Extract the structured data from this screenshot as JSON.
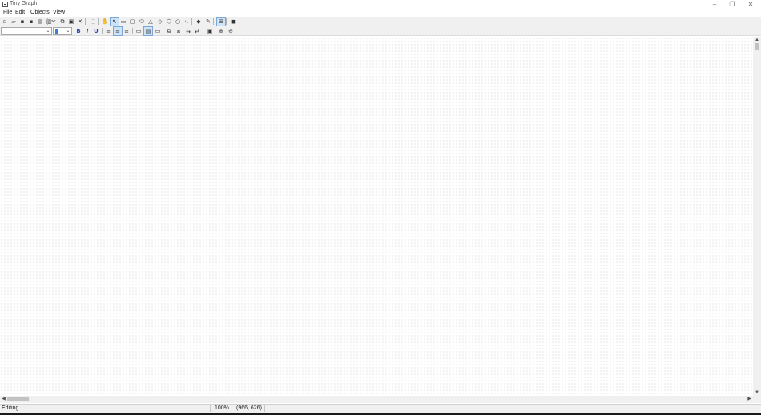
{
  "window": {
    "title": "Tiny Graph",
    "icon": "app-icon",
    "controls": {
      "minimize": "–",
      "maximize": "❐",
      "close": "✕"
    }
  },
  "menubar": [
    "File",
    "Edit",
    "Objects",
    "View"
  ],
  "toolbar1": [
    {
      "name": "new-icon",
      "glyph": "▫"
    },
    {
      "name": "open-icon",
      "glyph": "▱"
    },
    {
      "name": "save-icon",
      "glyph": "▪"
    },
    {
      "name": "save-as-icon",
      "glyph": "▪"
    },
    {
      "name": "print-preview-icon",
      "glyph": "▤"
    },
    {
      "name": "print-icon",
      "glyph": "▥"
    },
    {
      "name": "cut-icon",
      "glyph": "✂"
    },
    {
      "name": "copy-icon",
      "glyph": "⧉"
    },
    {
      "name": "paste-icon",
      "glyph": "▣"
    },
    {
      "name": "delete-icon",
      "glyph": "✕"
    },
    {
      "name": "select-all-icon",
      "glyph": "⬚"
    },
    {
      "name": "pan-hand-icon",
      "glyph": "✋"
    },
    {
      "name": "pointer-tool-icon",
      "glyph": "↖",
      "active": true
    },
    {
      "name": "rectangle-tool-icon",
      "glyph": "▭"
    },
    {
      "name": "rounded-rectangle-tool-icon",
      "glyph": "▢"
    },
    {
      "name": "ellipse-tool-icon",
      "glyph": "⬭"
    },
    {
      "name": "triangle-tool-icon",
      "glyph": "△"
    },
    {
      "name": "diamond-tool-icon",
      "glyph": "◇"
    },
    {
      "name": "hexagon-tool-icon",
      "glyph": "⬡"
    },
    {
      "name": "octagon-tool-icon",
      "glyph": "○"
    },
    {
      "name": "connector-tool-icon",
      "glyph": "⤷"
    },
    {
      "name": "fill-color-icon",
      "glyph": "◆"
    },
    {
      "name": "line-color-icon",
      "glyph": "✎"
    },
    {
      "name": "grid-toggle-icon",
      "glyph": "⊞",
      "active": true
    },
    {
      "name": "properties-icon",
      "glyph": "◼"
    }
  ],
  "font_combo": {
    "value": ""
  },
  "size_combo": {
    "value": ""
  },
  "toolbar2": [
    {
      "name": "bold-icon",
      "glyph": "B"
    },
    {
      "name": "italic-icon",
      "glyph": "I"
    },
    {
      "name": "underline-icon",
      "glyph": "U"
    },
    {
      "name": "align-left-icon",
      "glyph": "≡"
    },
    {
      "name": "align-center-icon",
      "glyph": "≡",
      "active": true
    },
    {
      "name": "align-right-icon",
      "glyph": "≡"
    },
    {
      "name": "layout-top-icon",
      "glyph": "▭"
    },
    {
      "name": "layout-middle-icon",
      "glyph": "▤",
      "active": true
    },
    {
      "name": "layout-bottom-icon",
      "glyph": "▭"
    },
    {
      "name": "group-icon",
      "glyph": "⧉"
    },
    {
      "name": "ungroup-icon",
      "glyph": "⧈"
    },
    {
      "name": "bring-to-front-icon",
      "glyph": "⇆"
    },
    {
      "name": "send-to-back-icon",
      "glyph": "⇄"
    },
    {
      "name": "page-setup-icon",
      "glyph": "▣"
    },
    {
      "name": "zoom-in-icon",
      "glyph": "⊕"
    },
    {
      "name": "zoom-out-icon",
      "glyph": "⊖"
    }
  ],
  "statusbar": {
    "mode": "Editing",
    "zoom": "100%",
    "coords": "(966, 626)"
  },
  "colors": {
    "accent": "#3b7fd6",
    "active_bg": "#cfe3f7",
    "grid_dot": "#c9c9c9",
    "toolbar_bg": "#f0f0f0"
  }
}
